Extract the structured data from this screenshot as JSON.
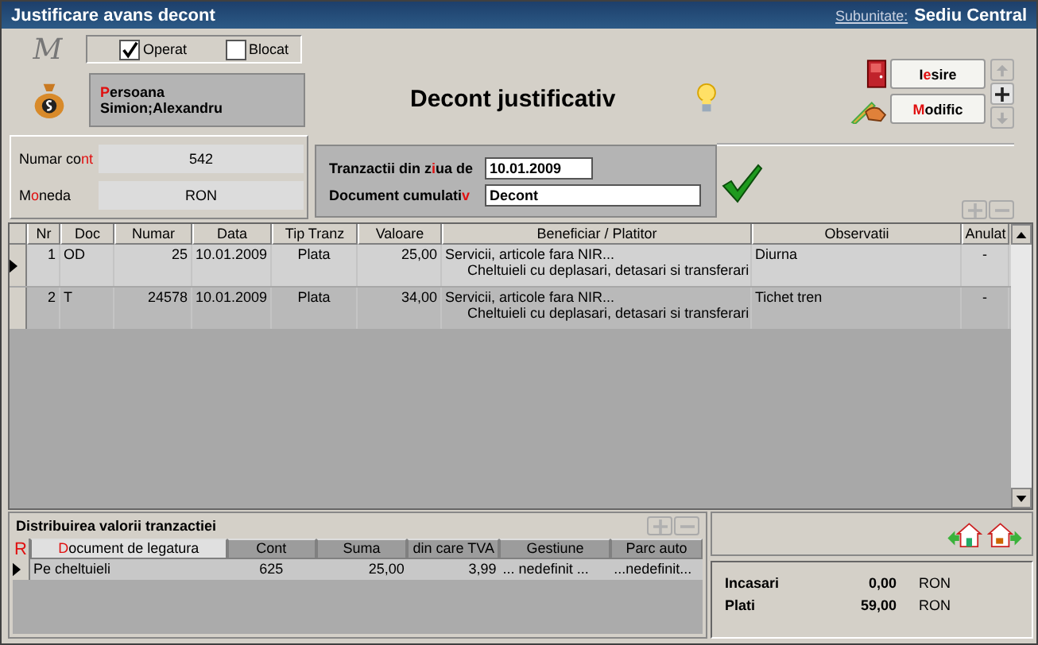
{
  "window": {
    "title": "Justificare avans decont",
    "subunit_label": "Subunitate:",
    "subunit_value": "Sediu Central"
  },
  "logo_glyph": "M",
  "flags": [
    {
      "label": "Operat",
      "checked": true
    },
    {
      "label": "Blocat",
      "checked": false
    }
  ],
  "person": {
    "label": [
      {
        "text": "P",
        "hot": true
      },
      {
        "text": "ersoana",
        "hot": false
      }
    ],
    "value": "Simion;Alexandru"
  },
  "account_fields": [
    {
      "label": [
        {
          "text": "Numar co",
          "hot": false
        },
        {
          "text": "nt",
          "hot": true
        }
      ],
      "value": "542"
    },
    {
      "label": [
        {
          "text": "M",
          "hot": false
        },
        {
          "text": "o",
          "hot": true
        },
        {
          "text": "neda",
          "hot": false
        }
      ],
      "value": "RON"
    }
  ],
  "heading": "Decont justificativ",
  "filters": [
    {
      "label": [
        {
          "text": "Tranzactii din z",
          "hot": false
        },
        {
          "text": "i",
          "hot": true
        },
        {
          "text": "ua de",
          "hot": false
        }
      ],
      "value": "10.01.2009",
      "kind": "short"
    },
    {
      "label": [
        {
          "text": "Document cumulati",
          "hot": false
        },
        {
          "text": "v",
          "hot": true
        }
      ],
      "value": "Decont",
      "kind": "long"
    }
  ],
  "buttons": [
    {
      "label": [
        {
          "text": "I",
          "hot": false
        },
        {
          "text": "e",
          "hot": true
        },
        {
          "text": "sire",
          "hot": false
        }
      ],
      "kind": "exit"
    },
    {
      "label": [
        {
          "text": "M",
          "hot": true
        },
        {
          "text": "odific",
          "hot": false
        }
      ],
      "kind": "edit"
    }
  ],
  "nav": [
    {
      "kind": "up",
      "disabled": true
    },
    {
      "kind": "plus",
      "disabled": false
    },
    {
      "kind": "down",
      "disabled": true
    }
  ],
  "grid_actions": [
    {
      "kind": "plus",
      "disabled": true
    },
    {
      "kind": "minus",
      "disabled": true
    }
  ],
  "table": {
    "columns": [
      "Nr",
      "Doc",
      "Numar",
      "Data",
      "Tip Tranz",
      "Valoare",
      "Beneficiar  / Platitor",
      "Observatii",
      "Anulat"
    ],
    "rows": [
      {
        "selected": true,
        "cells": [
          "1",
          "OD",
          "25",
          "10.01.2009",
          "Plata",
          "25,00",
          "Servicii, articole fara NIR...",
          "Diurna",
          "-"
        ],
        "detail": "Cheltuieli cu deplasari, detasari si transferari"
      },
      {
        "selected": false,
        "cells": [
          "2",
          "T",
          "24578",
          "10.01.2009",
          "Plata",
          "34,00",
          "Servicii, articole fara NIR...",
          "Tichet tren",
          "-"
        ],
        "detail": "Cheltuieli cu deplasari, detasari si transferari"
      }
    ]
  },
  "distribution": {
    "title": "Distribuirea valorii tranzactiei",
    "corner": "R",
    "actions": [
      {
        "kind": "plus",
        "disabled": true
      },
      {
        "kind": "minus",
        "disabled": true
      }
    ],
    "columns": [
      {
        "label": [
          {
            "text": "D",
            "hot": true
          },
          {
            "text": "ocument de legatura",
            "hot": false
          }
        ],
        "sorted": true
      },
      {
        "label": [
          {
            "text": "Cont",
            "hot": false
          }
        ],
        "sorted": false
      },
      {
        "label": [
          {
            "text": "Suma",
            "hot": false
          }
        ],
        "sorted": false
      },
      {
        "label": [
          {
            "text": "din care TVA",
            "hot": false
          }
        ],
        "sorted": false
      },
      {
        "label": [
          {
            "text": "Gestiune",
            "hot": false
          }
        ],
        "sorted": false
      },
      {
        "label": [
          {
            "text": "Parc auto",
            "hot": false
          }
        ],
        "sorted": false
      }
    ],
    "rows": [
      {
        "selected": true,
        "cells": [
          "Pe cheltuieli",
          "625",
          "25,00",
          "3,99",
          "... nedefinit ...",
          "...nedefinit..."
        ]
      }
    ]
  },
  "totals": [
    {
      "label": "Incasari",
      "value": "0,00",
      "currency": "RON"
    },
    {
      "label": "Plati",
      "value": "59,00",
      "currency": "RON"
    }
  ]
}
